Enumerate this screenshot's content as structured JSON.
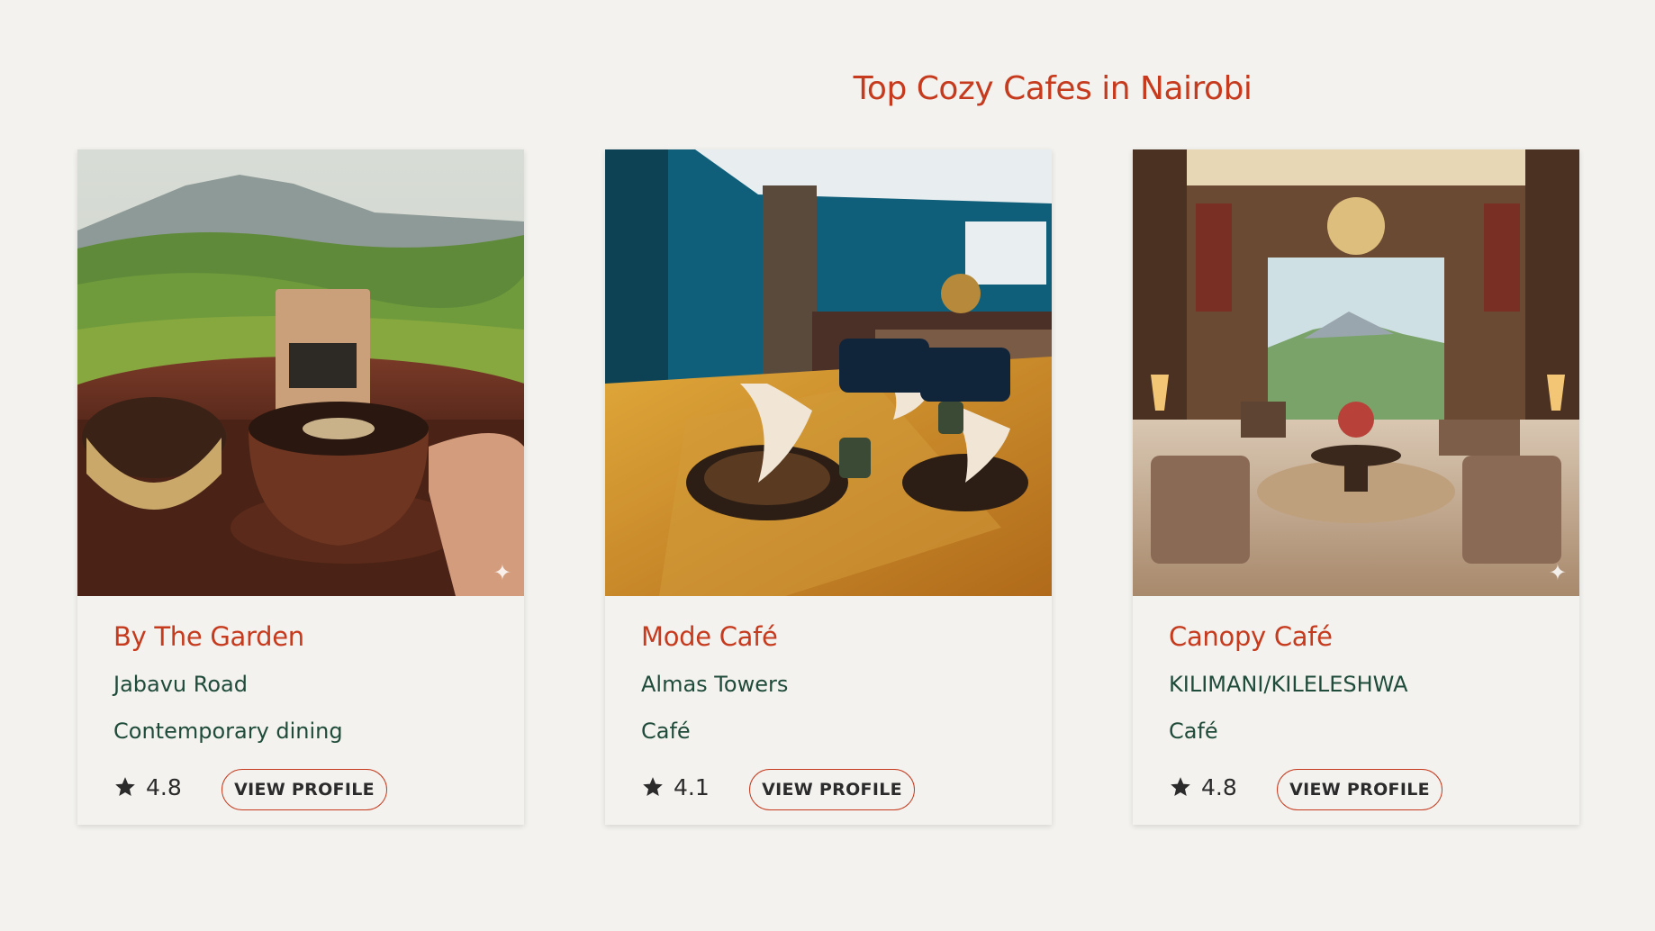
{
  "page_title": "Top Cozy Cafes in Nairobi",
  "colors": {
    "accent": "#c63a1e",
    "text_green": "#1f4b3b",
    "background": "#f3f2ee"
  },
  "cafes": [
    {
      "name": "By The Garden",
      "location": "Jabavu Road",
      "category": "Contemporary dining",
      "rating": "4.8",
      "button_label": "VIEW PROFILE",
      "image_icon": "coffee-tea-field-photo"
    },
    {
      "name": "Mode Café",
      "location": "Almas Towers",
      "category": "Café",
      "rating": "4.1",
      "button_label": "VIEW PROFILE",
      "image_icon": "dining-room-photo"
    },
    {
      "name": "Canopy Café",
      "location": "KILIMANI/KILELESHWA",
      "category": "Café",
      "rating": "4.8",
      "button_label": "VIEW PROFILE",
      "image_icon": "hotel-lobby-photo"
    }
  ]
}
